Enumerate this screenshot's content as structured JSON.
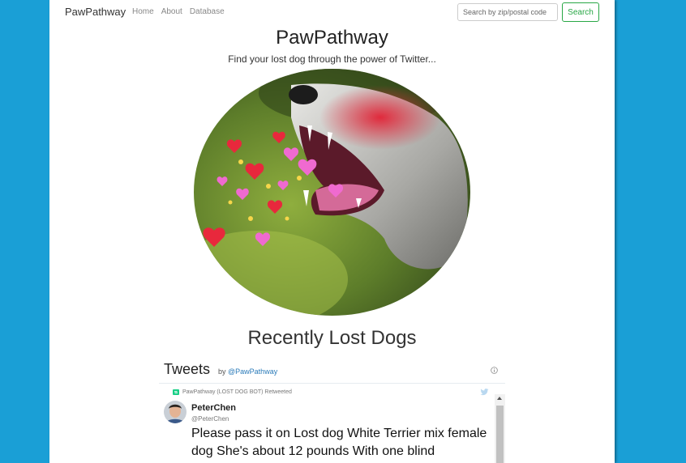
{
  "navbar": {
    "brand": "PawPathway",
    "links": [
      "Home",
      "About",
      "Database"
    ],
    "search": {
      "placeholder": "Search by zip/postal code",
      "value": ""
    },
    "search_button": "Search"
  },
  "hero": {
    "title": "PawPathway",
    "tagline": "Find your lost dog through the power of Twitter..."
  },
  "section": {
    "title": "Recently Lost Dogs"
  },
  "tweets_widget": {
    "title": "Tweets",
    "by_prefix": "by",
    "by_handle": "@PawPathway",
    "retweet_note": "PawPathway (LOST DOG BOT) Retweeted",
    "tweet": {
      "user_name": "PeterChen",
      "user_handle": "@PeterChen",
      "text": "Please pass it on Lost dog White Terrier mix female dog She's about 12 pounds With one blind"
    }
  },
  "colors": {
    "background": "#1a9fd6",
    "accent_green": "#28a745",
    "link_blue": "#2b7bb9"
  },
  "icons": [
    "info-icon",
    "retweet-icon",
    "twitter-bird-icon"
  ]
}
